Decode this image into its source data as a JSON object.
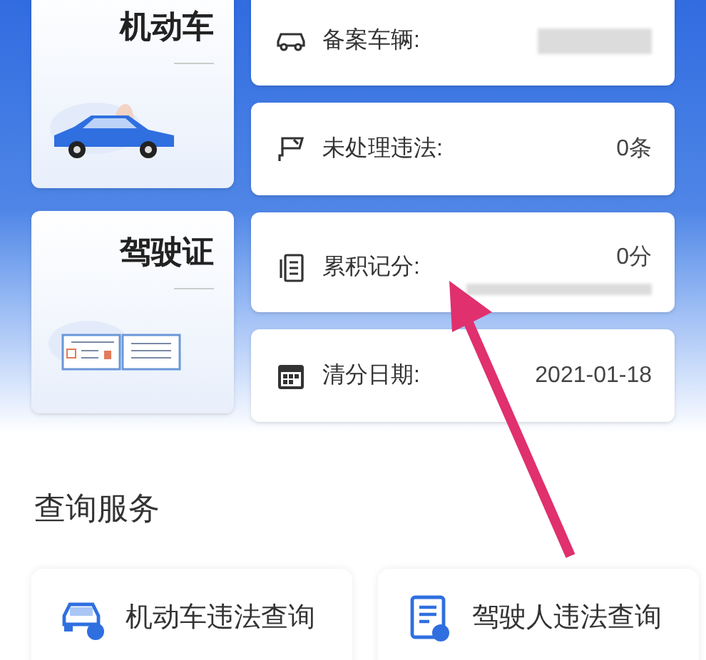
{
  "license_cards": [
    {
      "kind": "vehicle",
      "title": "机动车"
    },
    {
      "kind": "license",
      "title": "驾驶证"
    }
  ],
  "info_rows": [
    {
      "kind": "car",
      "label": "备案车辆:",
      "redacted": true
    },
    {
      "kind": "camera",
      "label": "未处理违法:",
      "value": "0条"
    },
    {
      "kind": "document",
      "label": "累积记分:",
      "value": "0分",
      "redacted": true
    },
    {
      "kind": "calendar",
      "label": "清分日期:",
      "value": "2021-01-18"
    }
  ],
  "section_title": "查询服务",
  "services": [
    {
      "kind": "car",
      "label": "机动车违法查询"
    },
    {
      "kind": "document",
      "label": "驾驶人违法查询"
    }
  ]
}
